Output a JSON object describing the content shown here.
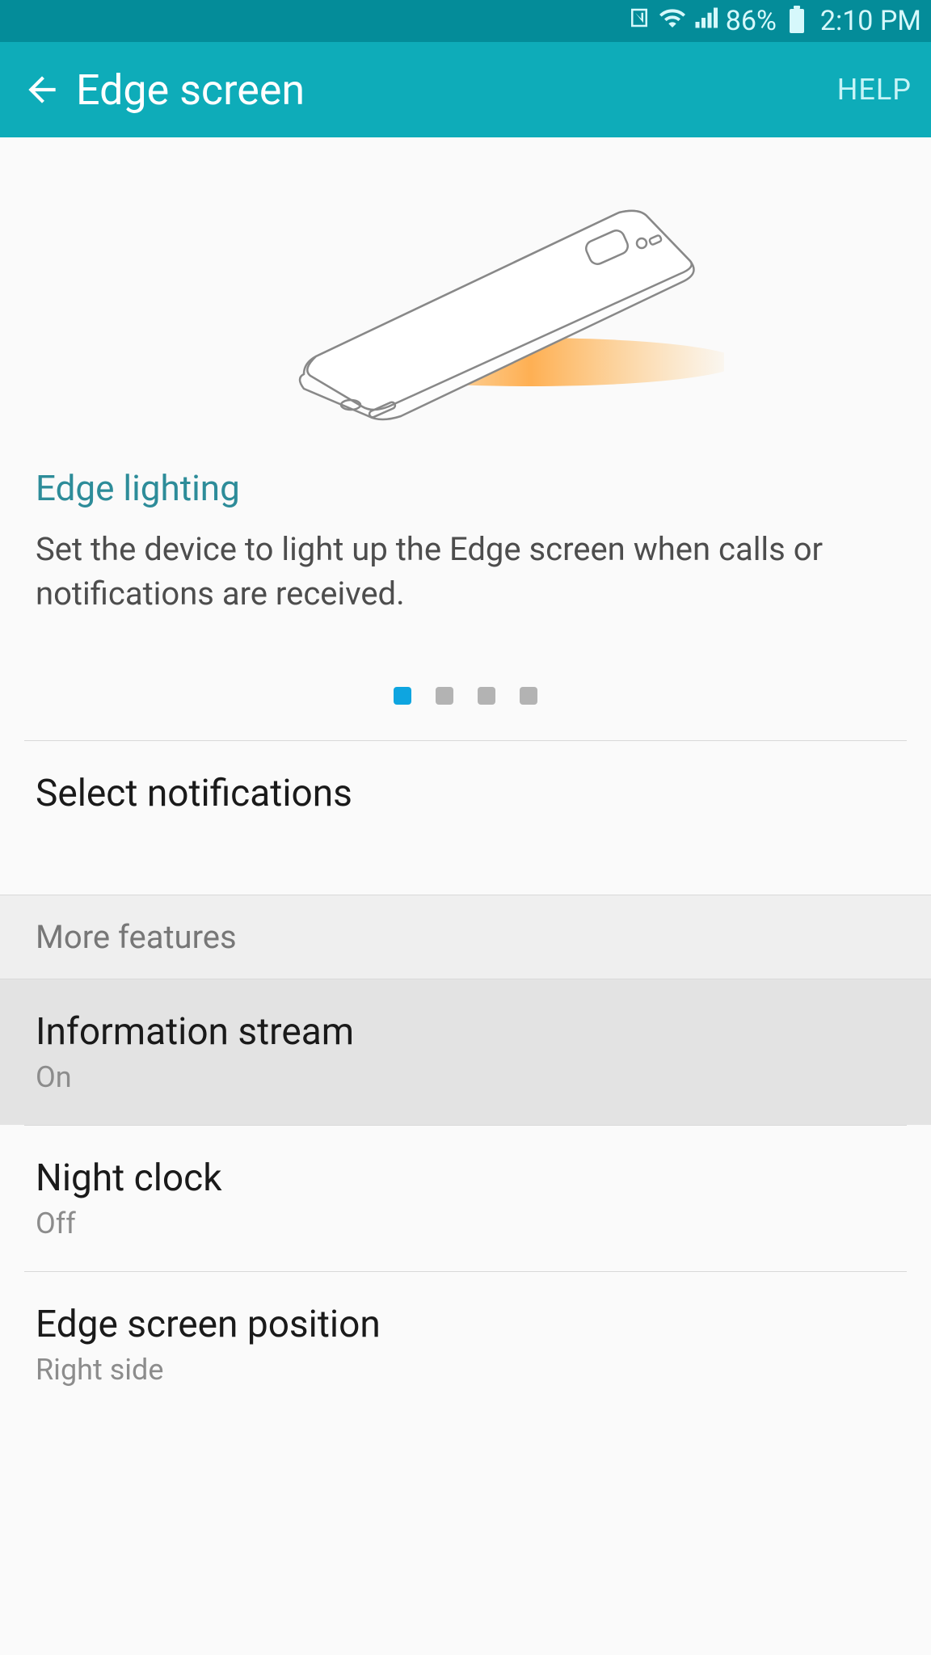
{
  "status_bar": {
    "battery_pct": "86%",
    "time": "2:10 PM"
  },
  "app_bar": {
    "title": "Edge screen",
    "help": "HELP"
  },
  "hero": {
    "title": "Edge lighting",
    "description": "Set the device to light up the Edge screen when calls or notifications are received."
  },
  "pager": {
    "count": 4,
    "active": 0
  },
  "items": {
    "select_notifications": "Select notifications",
    "section_more": "More features",
    "information_stream": {
      "label": "Information stream",
      "status": "On"
    },
    "night_clock": {
      "label": "Night clock",
      "status": "Off"
    },
    "edge_position": {
      "label": "Edge screen position",
      "status": "Right side"
    }
  }
}
